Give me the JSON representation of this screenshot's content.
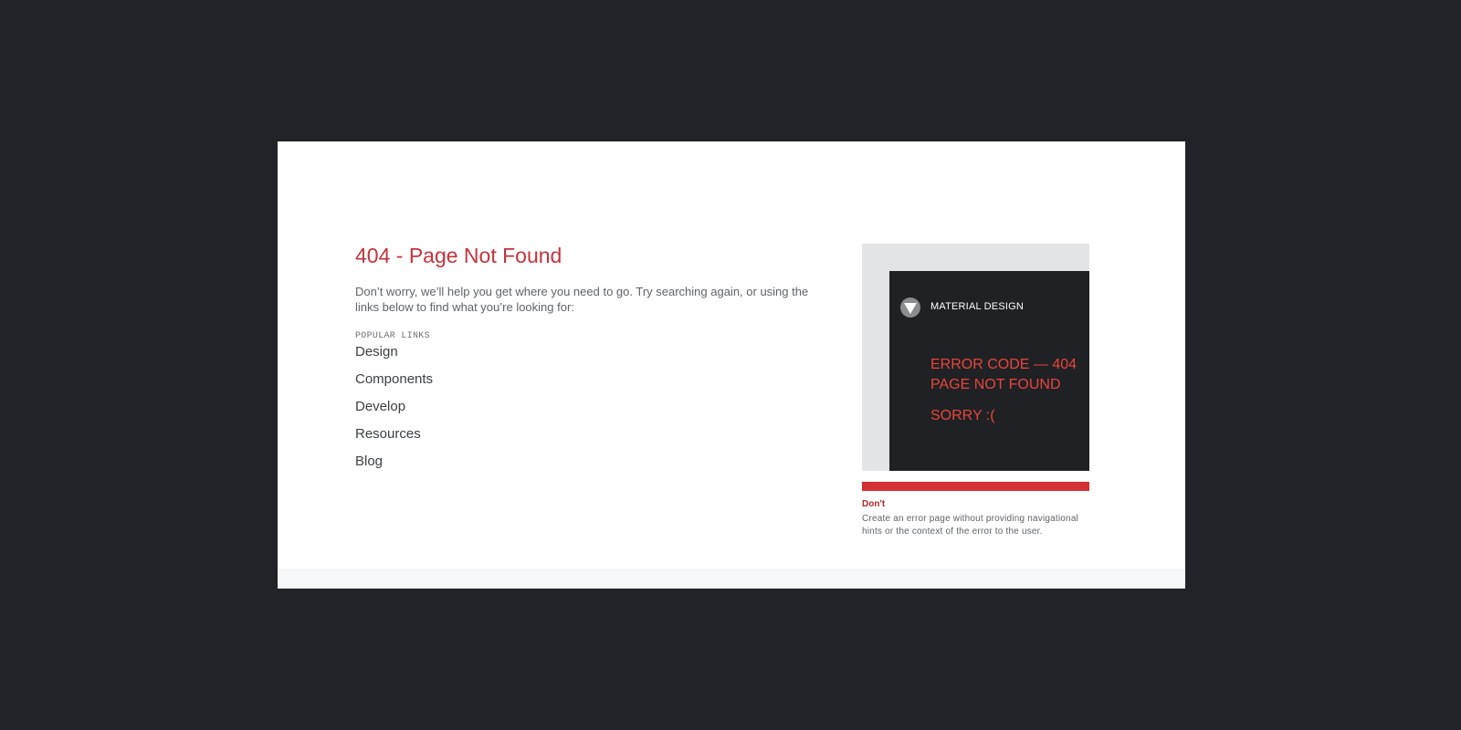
{
  "page": {
    "title": "404 - Page Not Found",
    "description": "Don’t worry, we’ll help you get where you need to go. Try searching again, or using the links below to find what you’re looking for:",
    "popular_label": "POPULAR LINKS",
    "links": [
      "Design",
      "Components",
      "Develop",
      "Resources",
      "Blog"
    ]
  },
  "figure": {
    "brand": "MATERIAL DESIGN",
    "error_line1": "ERROR CODE — 404",
    "error_line2": "PAGE NOT FOUND",
    "sorry": "SORRY :(",
    "dont_label": "Don't",
    "dont_desc": "Create an error page without providing navigational hints or the context of the error to the user."
  },
  "colors": {
    "background": "#212328",
    "title": "#c5333a",
    "error_text": "#e8453c",
    "dont_bar": "#d32f35"
  }
}
